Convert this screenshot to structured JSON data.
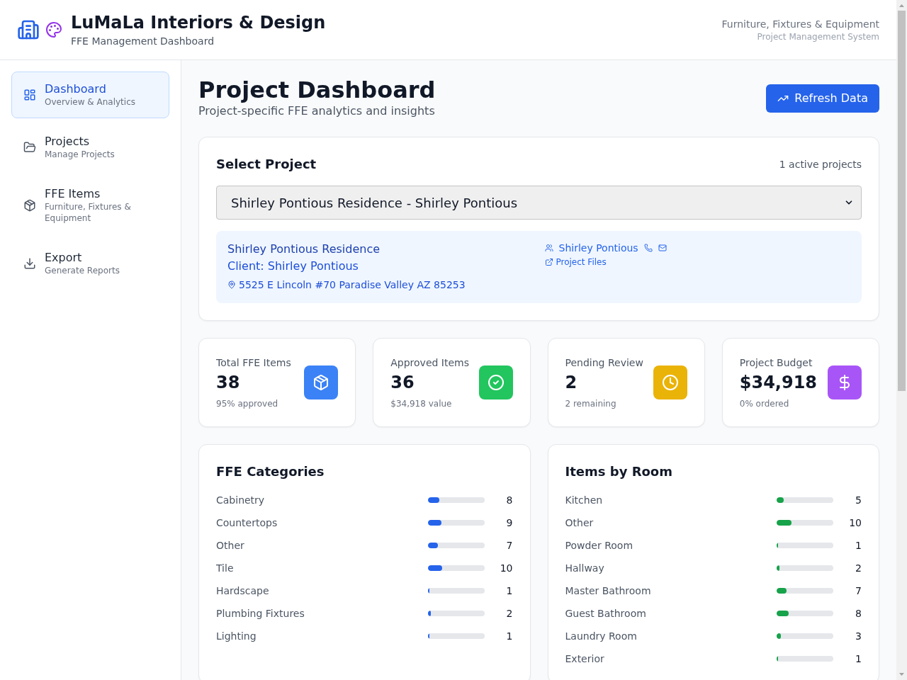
{
  "header": {
    "title": "LuMaLa Interiors & Design",
    "subtitle": "FFE Management Dashboard",
    "tagline": "Furniture, Fixtures & Equipment",
    "system": "Project Management System"
  },
  "sidebar": {
    "items": [
      {
        "title": "Dashboard",
        "subtitle": "Overview & Analytics",
        "selected": true
      },
      {
        "title": "Projects",
        "subtitle": "Manage Projects",
        "selected": false
      },
      {
        "title": "FFE Items",
        "subtitle": "Furniture, Fixtures & Equipment",
        "selected": false
      },
      {
        "title": "Export",
        "subtitle": "Generate Reports",
        "selected": false
      }
    ]
  },
  "page": {
    "title": "Project Dashboard",
    "subtitle": "Project-specific FFE analytics and insights",
    "refresh_button": "Refresh Data"
  },
  "project_selector": {
    "title": "Select Project",
    "count": "1 active projects",
    "value": "Shirley Pontious Residence - Shirley Pontious",
    "project": {
      "name": "Shirley Pontious Residence",
      "client": "Client: Shirley Pontious",
      "address": "5525 E Lincoln #70 Paradise Valley AZ 85253",
      "contact": "Shirley Pontious",
      "files_link": "Project Files"
    }
  },
  "stats": [
    {
      "label": "Total FFE Items",
      "value": "38",
      "note": "95% approved",
      "color": "#3b82f6"
    },
    {
      "label": "Approved Items",
      "value": "36",
      "note": "$34,918 value",
      "color": "#22c55e"
    },
    {
      "label": "Pending Review",
      "value": "2",
      "note": "2 remaining",
      "color": "#eab308"
    },
    {
      "label": "Project Budget",
      "value": "$34,918",
      "note": "0% ordered",
      "color": "#a855f7"
    }
  ],
  "panels": [
    {
      "title": "FFE Categories",
      "color": "#2563eb",
      "rows": [
        {
          "label": "Cabinetry",
          "count": "8",
          "level": 0.21
        },
        {
          "label": "Countertops",
          "count": "9",
          "level": 0.24
        },
        {
          "label": "Other",
          "count": "7",
          "level": 0.18
        },
        {
          "label": "Tile",
          "count": "10",
          "level": 0.26
        },
        {
          "label": "Hardscape",
          "count": "1",
          "level": 0.03
        },
        {
          "label": "Plumbing Fixtures",
          "count": "2",
          "level": 0.05
        },
        {
          "label": "Lighting",
          "count": "1",
          "level": 0.03
        }
      ]
    },
    {
      "title": "Items by Room",
      "color": "#16a34a",
      "rows": [
        {
          "label": "Kitchen",
          "count": "5",
          "level": 0.13
        },
        {
          "label": "Other",
          "count": "10",
          "level": 0.26
        },
        {
          "label": "Powder Room",
          "count": "1",
          "level": 0.03
        },
        {
          "label": "Hallway",
          "count": "2",
          "level": 0.05
        },
        {
          "label": "Master Bathroom",
          "count": "7",
          "level": 0.18
        },
        {
          "label": "Guest Bathroom",
          "count": "8",
          "level": 0.21
        },
        {
          "label": "Laundry Room",
          "count": "3",
          "level": 0.08
        },
        {
          "label": "Exterior",
          "count": "1",
          "level": 0.03
        }
      ]
    }
  ]
}
